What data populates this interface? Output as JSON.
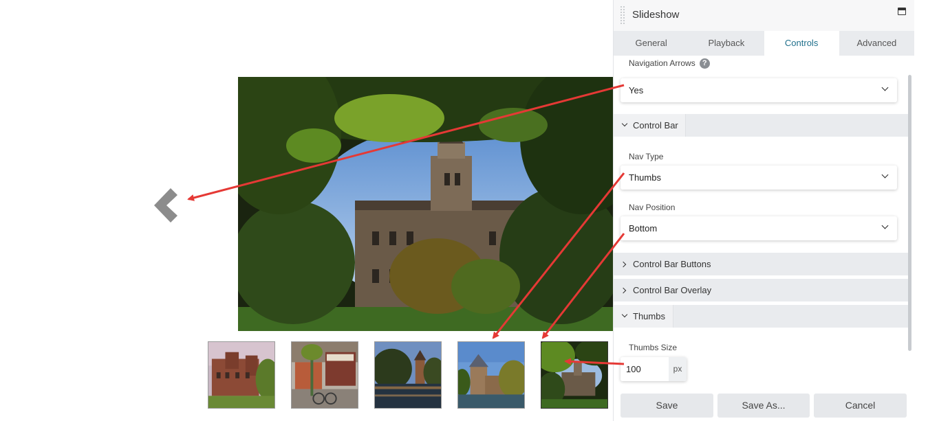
{
  "panel": {
    "title": "Slideshow",
    "tabs": [
      {
        "label": "General",
        "active": false
      },
      {
        "label": "Playback",
        "active": false
      },
      {
        "label": "Controls",
        "active": true
      },
      {
        "label": "Advanced",
        "active": false
      }
    ],
    "navigation_arrows": {
      "label": "Navigation Arrows",
      "value": "Yes"
    },
    "sections": {
      "control_bar": "Control Bar",
      "control_bar_buttons": "Control Bar Buttons",
      "control_bar_overlay": "Control Bar Overlay",
      "thumbs": "Thumbs"
    },
    "nav_type": {
      "label": "Nav Type",
      "value": "Thumbs"
    },
    "nav_position": {
      "label": "Nav Position",
      "value": "Bottom"
    },
    "thumbs_size": {
      "label": "Thumbs Size",
      "value": "100",
      "unit": "px"
    },
    "buttons": {
      "save": "Save",
      "save_as": "Save As...",
      "cancel": "Cancel"
    }
  },
  "colors": {
    "annotation_arrow": "#e53935",
    "active_tab_text": "#1f6f8b",
    "prev_arrow": "#8c8c8c"
  },
  "icons": {
    "prev": "chevron-left-icon",
    "help": "question-icon",
    "maximize": "maximize-icon"
  }
}
